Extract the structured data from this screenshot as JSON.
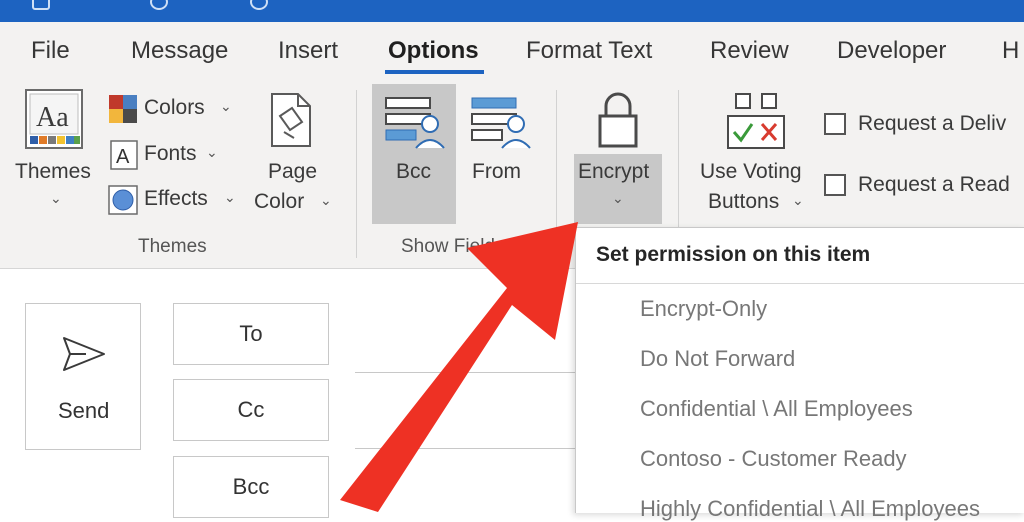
{
  "ribbon_tabs": [
    "File",
    "Message",
    "Insert",
    "Options",
    "Format Text",
    "Review",
    "Developer",
    "H"
  ],
  "active_tab": "Options",
  "themes_group": {
    "themes_label": "Themes",
    "colors_label": "Colors",
    "fonts_label": "Fonts",
    "effects_label": "Effects",
    "page_color_line1": "Page",
    "page_color_line2": "Color",
    "group_label": "Themes"
  },
  "show_fields_group": {
    "bcc_label": "Bcc",
    "from_label": "From",
    "group_label": "Show Fields"
  },
  "encrypt_label": "Encrypt",
  "tracking": {
    "voting_line1": "Use Voting",
    "voting_line2": "Buttons",
    "request_delivery": "Request a Deliv",
    "request_read": "Request a Read"
  },
  "compose": {
    "send_label": "Send",
    "to_label": "To",
    "cc_label": "Cc",
    "bcc_label": "Bcc"
  },
  "encrypt_menu": {
    "header": "Set permission on this item",
    "items": [
      "Encrypt-Only",
      "Do Not Forward",
      "Confidential \\ All Employees",
      "Contoso - Customer Ready",
      "Highly Confidential \\ All Employees"
    ]
  },
  "colors": {
    "title_bar": "#1d63c1",
    "ribbon_bg": "#f3f2f1",
    "arrow": "#ee3124",
    "selected_button": "#c8c8c8"
  }
}
